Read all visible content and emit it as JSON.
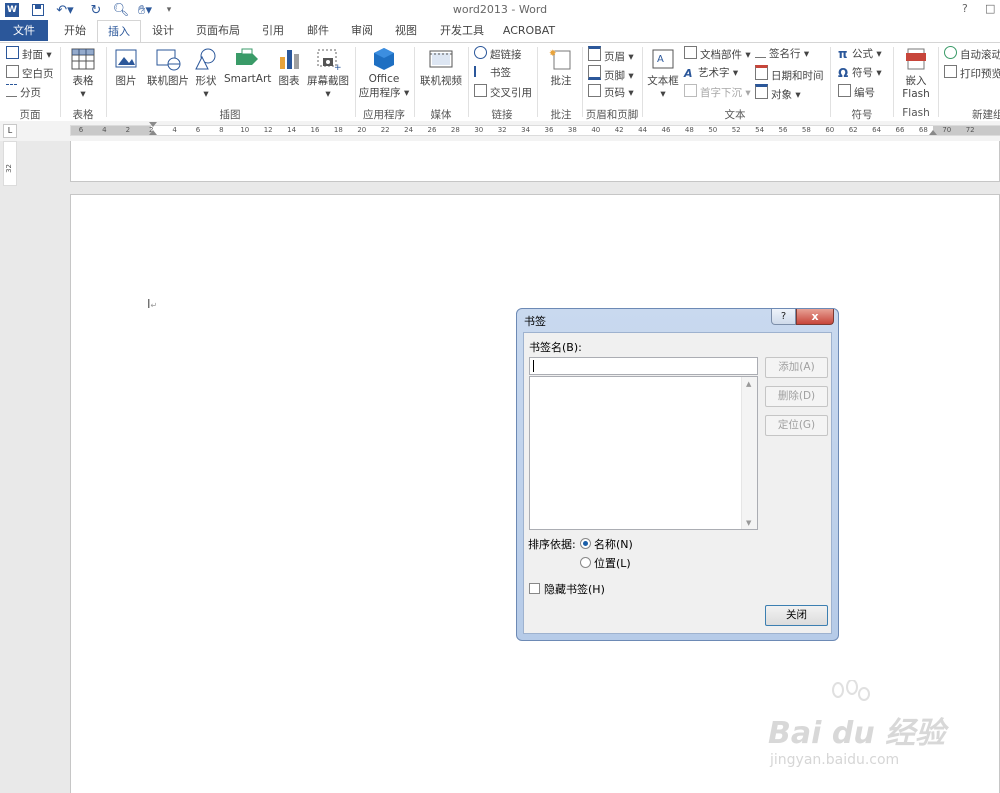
{
  "window": {
    "title": "word2013 - Word",
    "help": "?",
    "restore": "□"
  },
  "tabs": [
    {
      "label": "文件"
    },
    {
      "label": "开始"
    },
    {
      "label": "插入"
    },
    {
      "label": "设计"
    },
    {
      "label": "页面布局"
    },
    {
      "label": "引用"
    },
    {
      "label": "邮件"
    },
    {
      "label": "审阅"
    },
    {
      "label": "视图"
    },
    {
      "label": "开发工具"
    },
    {
      "label": "ACROBAT"
    }
  ],
  "ribbon": {
    "pages": {
      "cover": "封面",
      "blank": "空白页",
      "break": "分页",
      "label": "页面"
    },
    "tables": {
      "table": "表格",
      "label": "表格"
    },
    "illustrations": {
      "picture": "图片",
      "online_picture": "联机图片",
      "shapes": "形状",
      "smartart": "SmartArt",
      "chart": "图表",
      "screenshot": "屏幕截图",
      "label": "插图"
    },
    "apps": {
      "office_line1": "Office",
      "office_line2": "应用程序",
      "label": "应用程序"
    },
    "media": {
      "online_video": "联机视频",
      "label": "媒体"
    },
    "links": {
      "hyperlink": "超链接",
      "bookmark": "书签",
      "cross_ref": "交叉引用",
      "label": "链接"
    },
    "comments": {
      "comment": "批注",
      "label": "批注"
    },
    "header_footer": {
      "header": "页眉",
      "footer": "页脚",
      "page_number": "页码",
      "label": "页眉和页脚"
    },
    "text": {
      "textbox": "文本框",
      "quick_parts": "文档部件",
      "wordart": "艺术字",
      "dropcap": "首字下沉",
      "signature": "签名行",
      "datetime": "日期和时间",
      "object": "对象",
      "label": "文本"
    },
    "symbols": {
      "equation": "公式",
      "symbol": "符号",
      "number": "编号",
      "label": "符号"
    },
    "flash": {
      "embed_line1": "嵌入",
      "embed_line2": "Flash",
      "label": "Flash"
    },
    "new": {
      "autoscroll": "自动滚动",
      "print_preview": "打印预览",
      "label": "新建组"
    }
  },
  "ruler": {
    "corner": "L",
    "vertical_mark": "32",
    "ticks": [
      "6",
      "4",
      "2",
      "2",
      "4",
      "6",
      "8",
      "10",
      "12",
      "14",
      "16",
      "18",
      "20",
      "22",
      "24",
      "26",
      "28",
      "30",
      "32",
      "34",
      "36",
      "38",
      "40",
      "42",
      "44",
      "46",
      "48",
      "50",
      "52",
      "54",
      "56",
      "58",
      "60",
      "62",
      "64",
      "66",
      "68",
      "70",
      "72"
    ]
  },
  "dialog": {
    "title": "书签",
    "help": "?",
    "close": "x",
    "name_label": "书签名(B):",
    "name_value": "",
    "add": "添加(A)",
    "delete": "删除(D)",
    "goto": "定位(G)",
    "sort_label": "排序依据:",
    "sort_name": "名称(N)",
    "sort_location": "位置(L)",
    "hidden": "隐藏书签(H)",
    "close_button": "关闭"
  },
  "watermark": {
    "brand": "Bai du 经验",
    "url": "jingyan.baidu.com"
  },
  "colors": {
    "accent": "#2b579a",
    "dialog_frame": "#b6cbe8"
  }
}
